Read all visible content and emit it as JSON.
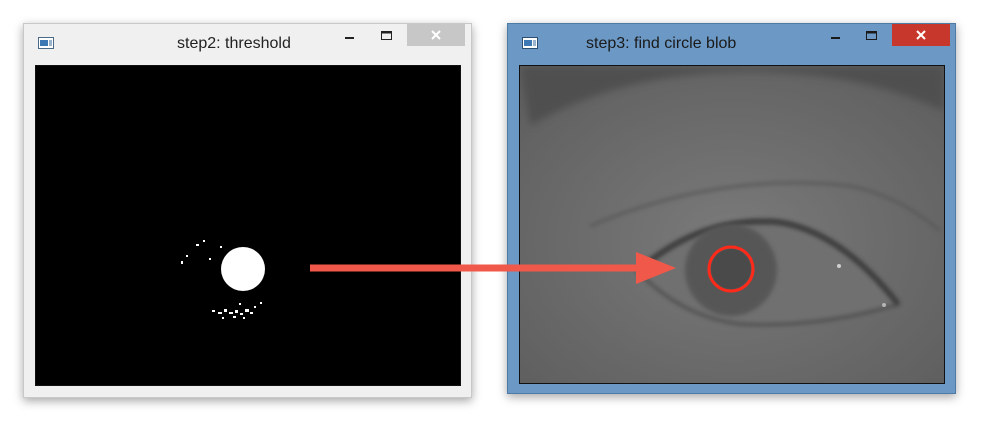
{
  "windows": [
    {
      "title": "step2: threshold",
      "controls": {
        "minimize_icon": "minimize-icon",
        "maximize_icon": "maximize-icon",
        "close_icon": "close-icon"
      }
    },
    {
      "title": "step3: find circle blob",
      "controls": {
        "minimize_icon": "minimize-icon",
        "maximize_icon": "maximize-icon",
        "close_icon": "close-icon"
      }
    }
  ],
  "colors": {
    "arrow": "#f0584a",
    "detected_circle": "#ff2a1a",
    "active_frame": "#6b98c4",
    "close_button_active": "#c8372c",
    "close_button_inactive": "#c7c7c7"
  }
}
